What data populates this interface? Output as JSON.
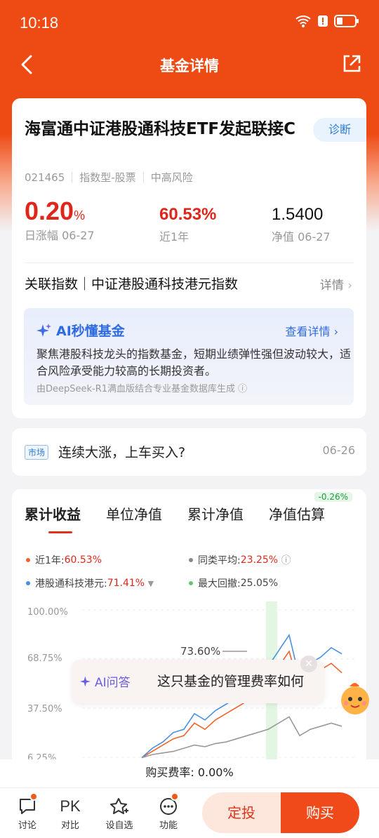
{
  "status_bar": {
    "time": "10:18"
  },
  "nav": {
    "title": "基金详情"
  },
  "fund": {
    "name": "海富通中证港股通科技ETF发起联接C",
    "diagnose": "诊断",
    "code": "021465",
    "type": "指数型-股票",
    "risk": "中高风险",
    "daily_change": "0.20",
    "daily_unit": "%",
    "daily_label": "日涨幅 06-27",
    "year_return": "60.53%",
    "year_label": "近1年",
    "nav_value": "1.5400",
    "nav_label": "净值 06-27",
    "related_index": "关联指数｜中证港股通科技港元指数",
    "related_more": "详情"
  },
  "ai": {
    "title": "AI秒懂基金",
    "more": "查看详情",
    "body": "聚焦港股科技龙头的指数基金，短期业绩弹性强但波动较大，适合风险承受能力较高的长期投资者。",
    "source": "由DeepSeek-R1满血版结合专业基金数据库生成"
  },
  "news": {
    "tag": "市场",
    "text": "连续大涨，上车买入?",
    "date": "06-26"
  },
  "chart_tabs": [
    "累计收益",
    "单位净值",
    "累计净值",
    "净值估算"
  ],
  "estimate_badge": "-0.26%",
  "legend": {
    "fund": {
      "label": "近1年:",
      "value": "60.53%",
      "color": "#f0632a"
    },
    "peer": {
      "label": "同类平均:",
      "value": "23.25%",
      "color": "#888888"
    },
    "index": {
      "label": "港股通科技港元:",
      "value": "71.41%",
      "color": "#4a90e2"
    },
    "drawdown": {
      "label": "最大回撤:",
      "value": "25.05%",
      "color": "#6bc46b"
    }
  },
  "chart_data": {
    "type": "line",
    "y_ticks": [
      "100.00%",
      "68.75%",
      "37.50%",
      "6.25%"
    ],
    "annotation": "73.60%",
    "series": [
      {
        "name": "近1年",
        "values": [
          6,
          10,
          14,
          18,
          20,
          28,
          24,
          30,
          34,
          38,
          42,
          46,
          55,
          64,
          73.6,
          50,
          58,
          62,
          66,
          60
        ]
      },
      {
        "name": "港股通科技港元",
        "values": [
          6,
          12,
          16,
          22,
          24,
          34,
          30,
          36,
          40,
          44,
          50,
          54,
          64,
          74,
          84,
          56,
          66,
          70,
          76,
          72
        ]
      },
      {
        "name": "同类平均",
        "values": [
          6,
          8,
          9,
          10,
          12,
          14,
          13,
          15,
          16,
          18,
          20,
          22,
          24,
          28,
          32,
          20,
          24,
          26,
          28,
          26
        ]
      }
    ]
  },
  "ai_question": {
    "label": "AI问答",
    "text": "这只基金的管理费率如何"
  },
  "purchase_rate": "购买费率: 0.00%",
  "bottom": {
    "discuss": "讨论",
    "pk": "PK",
    "compare": "对比",
    "watch": "设自选",
    "func": "功能",
    "fixed_invest": "定投",
    "buy": "购买"
  }
}
